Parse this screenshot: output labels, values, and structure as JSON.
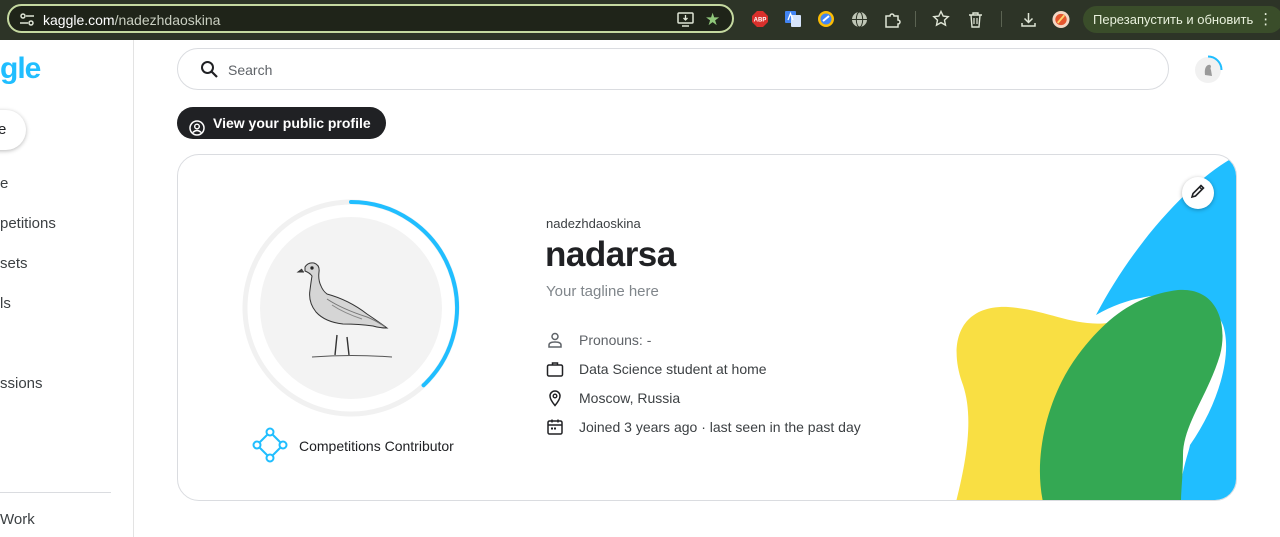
{
  "browser": {
    "url_host": "kaggle.com",
    "url_path": "/nadezhdaoskina",
    "icons": [
      "tune-icon",
      "install-app-icon",
      "bookmark-star-icon",
      "adblock-plus-icon",
      "google-translate-icon",
      "speed-icon",
      "globe-icon",
      "extensions-puzzle-icon",
      "reading-list-star-icon",
      "trash-icon",
      "download-icon",
      "profile-avatar-icon",
      "more-vert-icon"
    ],
    "abp_label": "ABP",
    "restart_label": "Перезапустить и обновить",
    "colors": {
      "chrome_bg": "#2d3427",
      "url_border": "#c5d9a0",
      "restart_bg": "#3a4d2a"
    }
  },
  "sidebar": {
    "logo": "gle",
    "create_label": "e",
    "items": [
      {
        "label": "e"
      },
      {
        "label": "petitions"
      },
      {
        "label": "sets"
      },
      {
        "label": "ls"
      },
      {
        "label": ""
      },
      {
        "label": "ssions"
      },
      {
        "label": ""
      },
      {
        "label": "Work"
      }
    ]
  },
  "search": {
    "placeholder": "Search"
  },
  "profile": {
    "public_profile_button": "View your public profile",
    "username": "nadezhdaoskina",
    "display_name": "nadarsa",
    "tagline": "Your tagline here",
    "tier": "Competitions Contributor",
    "tier_progress": 0.38,
    "info": [
      {
        "icon": "person-icon",
        "text": "Pronouns: -"
      },
      {
        "icon": "briefcase-icon",
        "text": "Data Science student at home"
      },
      {
        "icon": "location-pin-icon",
        "text": "Moscow, Russia"
      },
      {
        "icon": "calendar-icon",
        "text": "Joined 3 years ago · last seen in the past day"
      }
    ],
    "colors": {
      "accent": "#20beff",
      "blob_blue": "#20beff",
      "blob_yellow": "#f9df43",
      "blob_green": "#34a853"
    }
  }
}
